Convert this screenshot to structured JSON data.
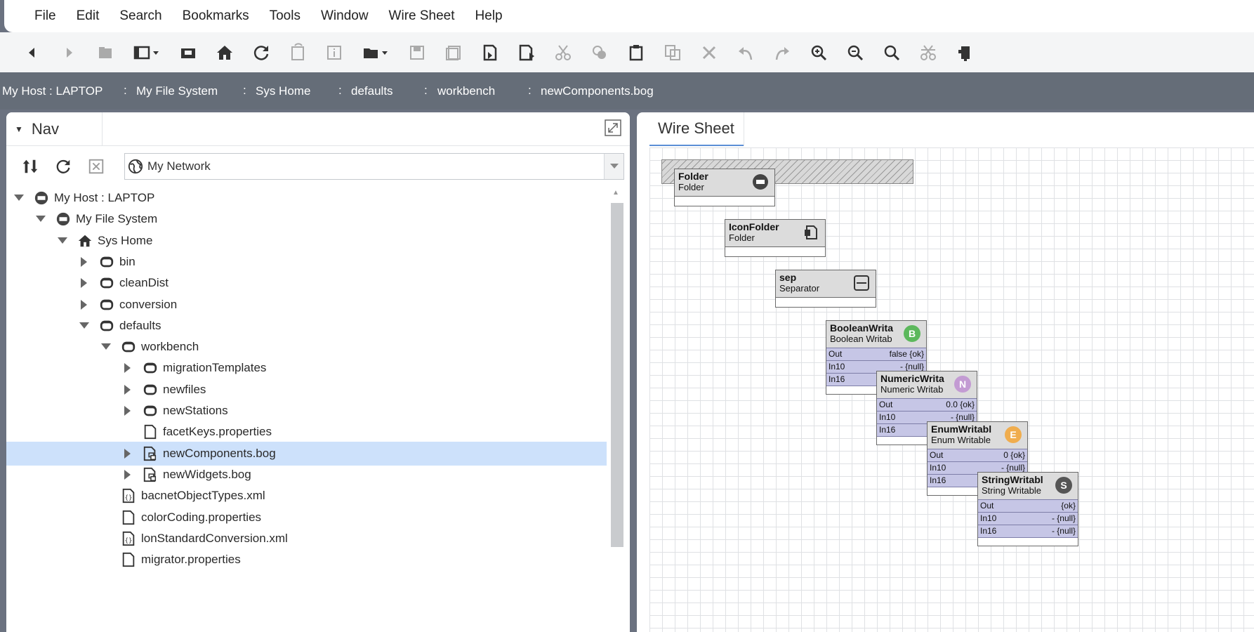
{
  "menu": [
    "File",
    "Edit",
    "Search",
    "Bookmarks",
    "Tools",
    "Window",
    "Wire Sheet",
    "Help"
  ],
  "toolbar_icons": [
    "back-icon",
    "forward-icon",
    "up-level-icon",
    "side-bar-icon",
    "console-icon",
    "home-icon",
    "refresh-icon",
    "cancel-refresh-icon",
    "info-icon",
    "open-icon",
    "save-icon",
    "save-all-icon",
    "export-icon",
    "print-icon",
    "cut-icon",
    "copy-icon",
    "paste-icon",
    "duplicate-icon",
    "delete-icon",
    "undo-icon",
    "redo-icon",
    "zoom-in-icon",
    "zoom-out-icon",
    "find-icon",
    "cut-link-icon",
    "trash-icon"
  ],
  "breadcrumb": [
    "My Host : LAPTOP",
    "My File System",
    "Sys Home",
    "defaults",
    "workbench",
    "newComponents.bog"
  ],
  "nav": {
    "title": "Nav",
    "selector": "My Network",
    "tree": [
      {
        "label": "My Host : LAPTOP",
        "expanded": true,
        "icon": "host"
      },
      {
        "label": "My File System",
        "expanded": true,
        "icon": "host"
      },
      {
        "label": "Sys Home",
        "expanded": true,
        "icon": "home"
      },
      {
        "label": "bin",
        "expanded": false,
        "icon": "folder"
      },
      {
        "label": "cleanDist",
        "expanded": false,
        "icon": "folder"
      },
      {
        "label": "conversion",
        "expanded": false,
        "icon": "folder"
      },
      {
        "label": "defaults",
        "expanded": true,
        "icon": "folder"
      },
      {
        "label": "workbench",
        "expanded": true,
        "icon": "folder"
      },
      {
        "label": "migrationTemplates",
        "expanded": false,
        "icon": "folder"
      },
      {
        "label": "newfiles",
        "expanded": false,
        "icon": "folder"
      },
      {
        "label": "newStations",
        "expanded": false,
        "icon": "folder"
      },
      {
        "label": "facetKeys.properties",
        "icon": "file"
      },
      {
        "label": "newComponents.bog",
        "expanded": false,
        "icon": "bog",
        "selected": true
      },
      {
        "label": "newWidgets.bog",
        "expanded": false,
        "icon": "bog"
      },
      {
        "label": "bacnetObjectTypes.xml",
        "icon": "xml"
      },
      {
        "label": "colorCoding.properties",
        "icon": "file"
      },
      {
        "label": "lonStandardConversion.xml",
        "icon": "xml"
      },
      {
        "label": "migrator.properties",
        "icon": "file"
      }
    ]
  },
  "wiresheet": {
    "title": "Wire Sheet",
    "components": [
      {
        "name": "Folder",
        "type": "Folder",
        "badge": "folder"
      },
      {
        "name": "IconFolder",
        "type": "Folder",
        "badge": "icon-folder"
      },
      {
        "name": "sep",
        "type": "Separator",
        "badge": "separator"
      },
      {
        "name": "BooleanWrita",
        "type": "Boolean Writab",
        "badge": "B",
        "badge_color": "#5cb85c",
        "slots": [
          {
            "name": "Out",
            "value": "false {ok}"
          },
          {
            "name": "In10",
            "value": "- {null}"
          },
          {
            "name": "In16",
            "value": "- {null}"
          }
        ]
      },
      {
        "name": "NumericWrita",
        "type": "Numeric Writab",
        "badge": "N",
        "badge_color": "#c39bd3",
        "slots": [
          {
            "name": "Out",
            "value": "0.0 {ok}"
          },
          {
            "name": "In10",
            "value": "- {null}"
          },
          {
            "name": "In16",
            "value": "- {null}"
          }
        ]
      },
      {
        "name": "EnumWritabl",
        "type": "Enum Writable",
        "badge": "E",
        "badge_color": "#f0ad4e",
        "slots": [
          {
            "name": "Out",
            "value": "0 {ok}"
          },
          {
            "name": "In10",
            "value": "- {null}"
          },
          {
            "name": "In16",
            "value": "- {null}"
          }
        ]
      },
      {
        "name": "StringWritabl",
        "type": "String Writable",
        "badge": "S",
        "badge_color": "#555555",
        "slots": [
          {
            "name": "Out",
            "value": "{ok}"
          },
          {
            "name": "In10",
            "value": "- {null}"
          },
          {
            "name": "In16",
            "value": "- {null}"
          }
        ]
      }
    ]
  }
}
